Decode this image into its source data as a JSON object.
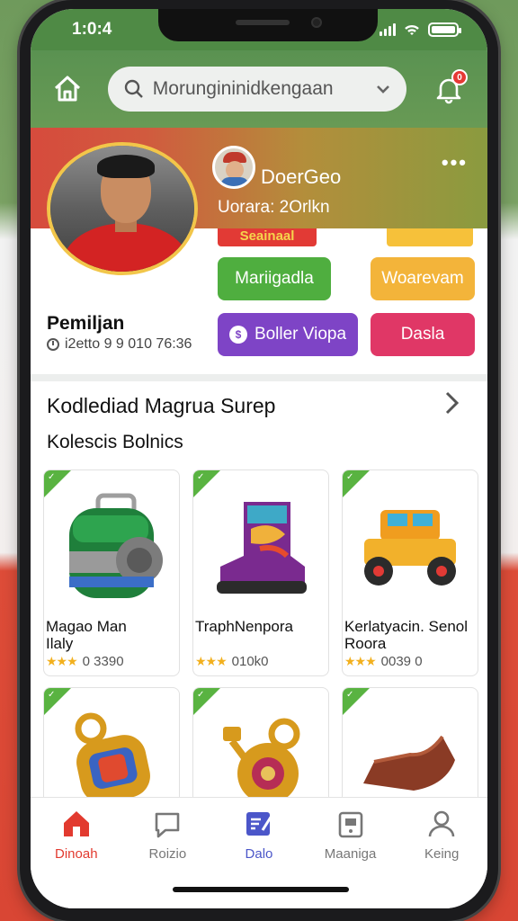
{
  "status_bar": {
    "time": "1:0:4"
  },
  "top_bar": {
    "search_placeholder": "Morungininidkengaan",
    "notification_count": "0"
  },
  "profile": {
    "mini_name": "DoerGeo",
    "mini_subtitle": "Uorara: 2Orlkn",
    "hint_label": "Seainaal",
    "buttons": {
      "green": "Mariigadla",
      "orange": "Woarevam",
      "purple": "Boller Viopa",
      "red": "Dasla"
    },
    "player_name": "Pemiljan",
    "player_meta": "i2etto 9 9 010 76:36"
  },
  "collection": {
    "title": "Kodlediad Magrua Surep",
    "subtitle": "Kolescis Bolnics",
    "items": [
      {
        "name": "Magao Man\nIlaly",
        "score": "0 3390",
        "stars": "★★★"
      },
      {
        "name": "TraphNenpora",
        "score": "010k0",
        "stars": "★★★"
      },
      {
        "name": "Kerlatyacin. Senol\nRoora",
        "score": "0039 0",
        "stars": "★★★"
      },
      {
        "name": "",
        "score": "",
        "stars": ""
      },
      {
        "name": "",
        "score": "",
        "stars": ""
      },
      {
        "name": "",
        "score": "",
        "stars": ""
      }
    ]
  },
  "bottom_nav": [
    {
      "label": "Dinoah",
      "icon": "home-icon",
      "state": "active"
    },
    {
      "label": "Roizio",
      "icon": "chat-icon",
      "state": ""
    },
    {
      "label": "Dalo",
      "icon": "edit-icon",
      "state": "selected"
    },
    {
      "label": "Maaniga",
      "icon": "device-icon",
      "state": ""
    },
    {
      "label": "Keing",
      "icon": "user-icon",
      "state": ""
    }
  ],
  "colors": {
    "primary_green": "#4f8a45",
    "accent_red": "#e23a2f",
    "accent_purple": "#7e44c6",
    "accent_orange": "#f3b43a",
    "accent_pink": "#e03766",
    "chip_green": "#4fae3f"
  }
}
